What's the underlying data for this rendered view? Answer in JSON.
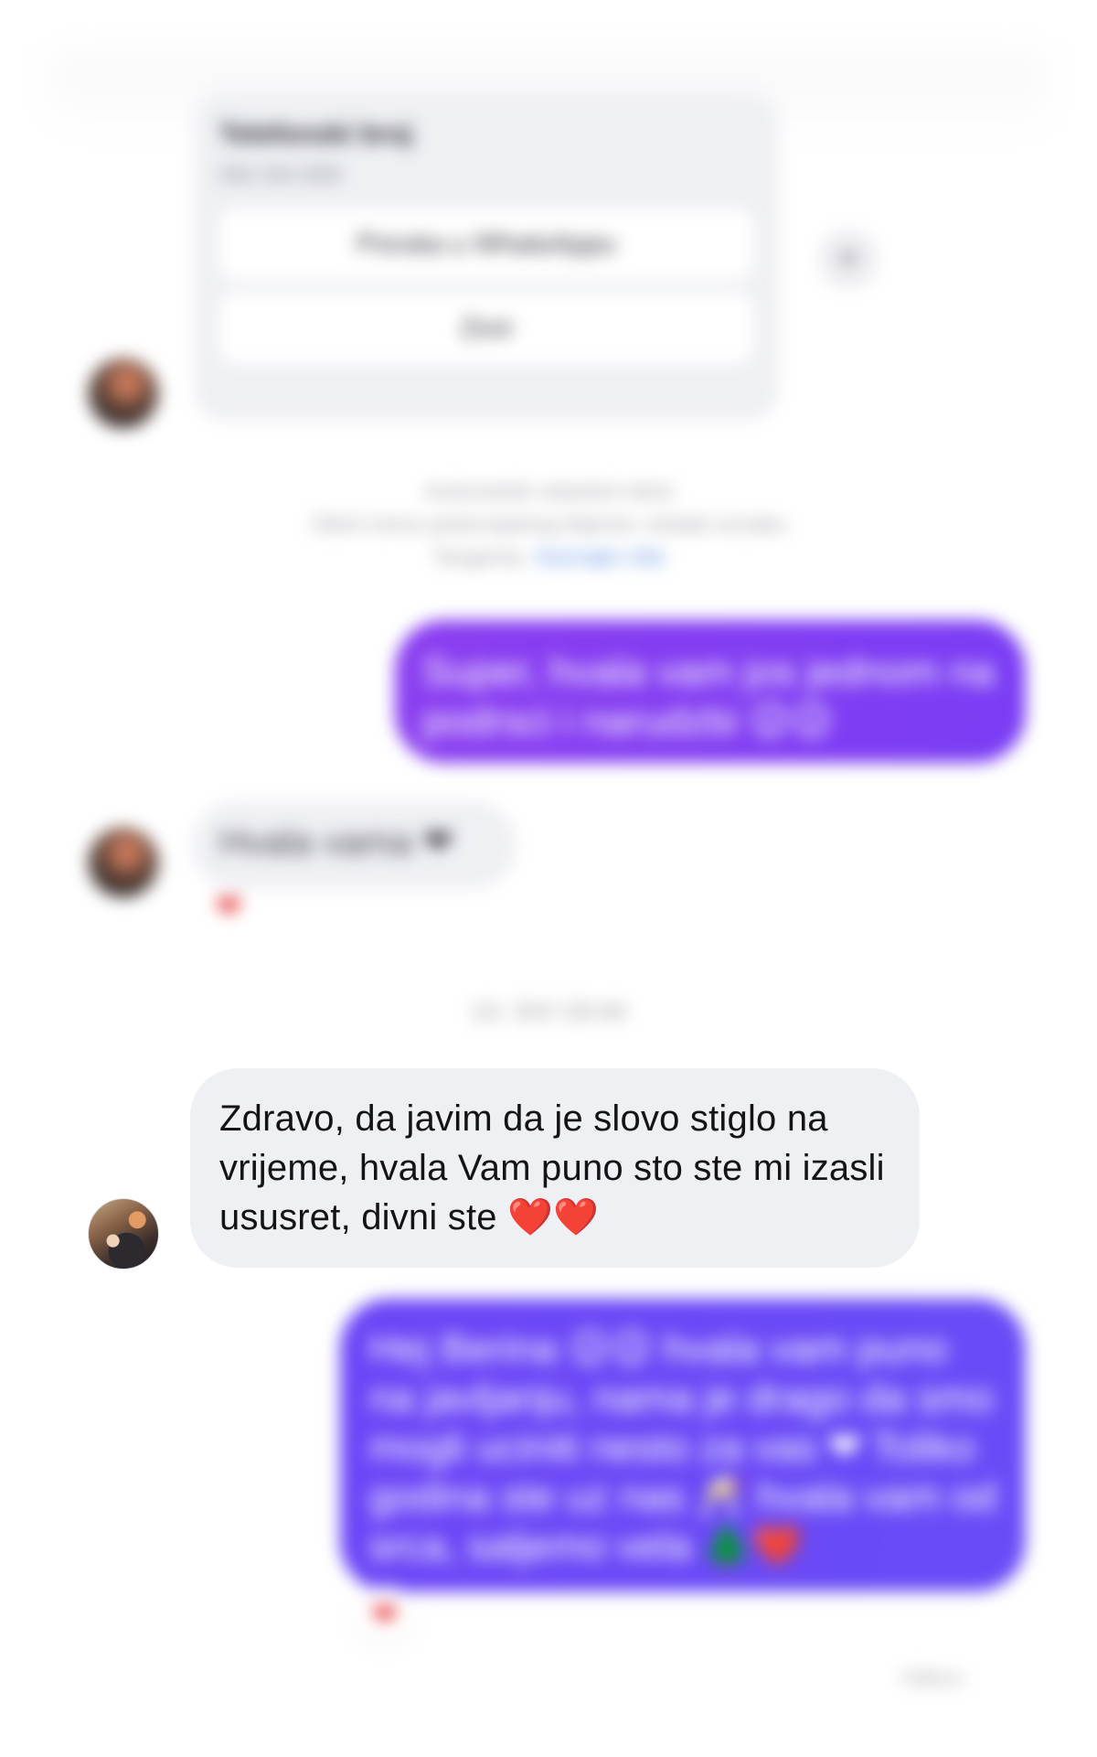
{
  "contact_card": {
    "title": "Telefonski broj",
    "number": "062 554 809",
    "whatsapp_button": "Poruka u WhatsAppu",
    "call_button": "Zovi"
  },
  "share_icon": "share-funnel-icon",
  "notice": {
    "line1": "Automatski odaslani tekst",
    "line2": "Otkrit ćemo potencijalnog klijenta i dodati oznaku",
    "line3_text": "Tangenta.",
    "line3_link": "Saznajte više"
  },
  "messages": {
    "outgoing_1": "Super, hvala vam jos jednom na podrsci i narudzbi 😉😉",
    "incoming_1": "Hvala vama ❤",
    "incoming_1_reaction": "❤",
    "timestamp": "14. SVI 19:44",
    "incoming_2": "Zdravo, da javim da je slovo stiglo na vrijeme, hvala Vam puno sto ste mi izasli ususret, divni ste ❤️❤️",
    "outgoing_2": "Hej Berina 😉😉 hvala vam puno na javljanju, nama je drago da smo mogli uciniti nesto za vas ❤ Toliko godina ste uz nas 🥂 hvala vam od srca, saljemo vela 🌲❤️",
    "outgoing_2_reaction": "❤",
    "status": "Viđeno"
  },
  "colors": {
    "outgoing_bubble_1": "#8b3ef0",
    "outgoing_bubble_2": "#6b45f6",
    "incoming_bubble": "#eff0f4",
    "heart": "#e2211c"
  }
}
